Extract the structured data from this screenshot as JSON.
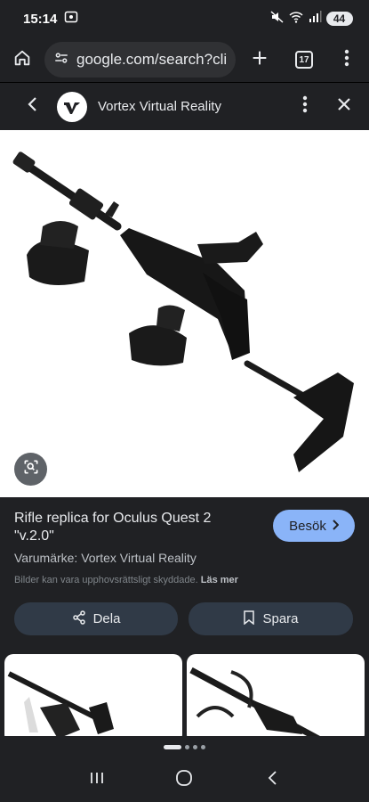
{
  "status_bar": {
    "time": "15:14",
    "battery": "44"
  },
  "browser": {
    "url": "google.com/search?clier",
    "tab_count": "17"
  },
  "panel": {
    "site_name": "Vortex Virtual Reality",
    "logo_text": "VR"
  },
  "result": {
    "title": "Rifle replica for Oculus Quest 2 \"v.2.0\"",
    "visit_label": "Besök",
    "brand": "Varumärke: Vortex Virtual Reality",
    "copyright": "Bilder kan vara upphovsrättsligt skyddade.",
    "more_label": "Läs mer",
    "share_label": "Dela",
    "save_label": "Spara"
  },
  "colors": {
    "accent": "#8ab4f8",
    "background": "#202124",
    "pill": "#303a47"
  },
  "icons": [
    "home-icon",
    "site-info-icon",
    "plus-icon",
    "tabs-icon",
    "more-vert-icon",
    "back-icon",
    "close-icon",
    "lens-icon",
    "chevron-right-icon",
    "share-icon",
    "bookmark-icon",
    "recents-icon",
    "home-nav-icon",
    "back-nav-icon"
  ]
}
